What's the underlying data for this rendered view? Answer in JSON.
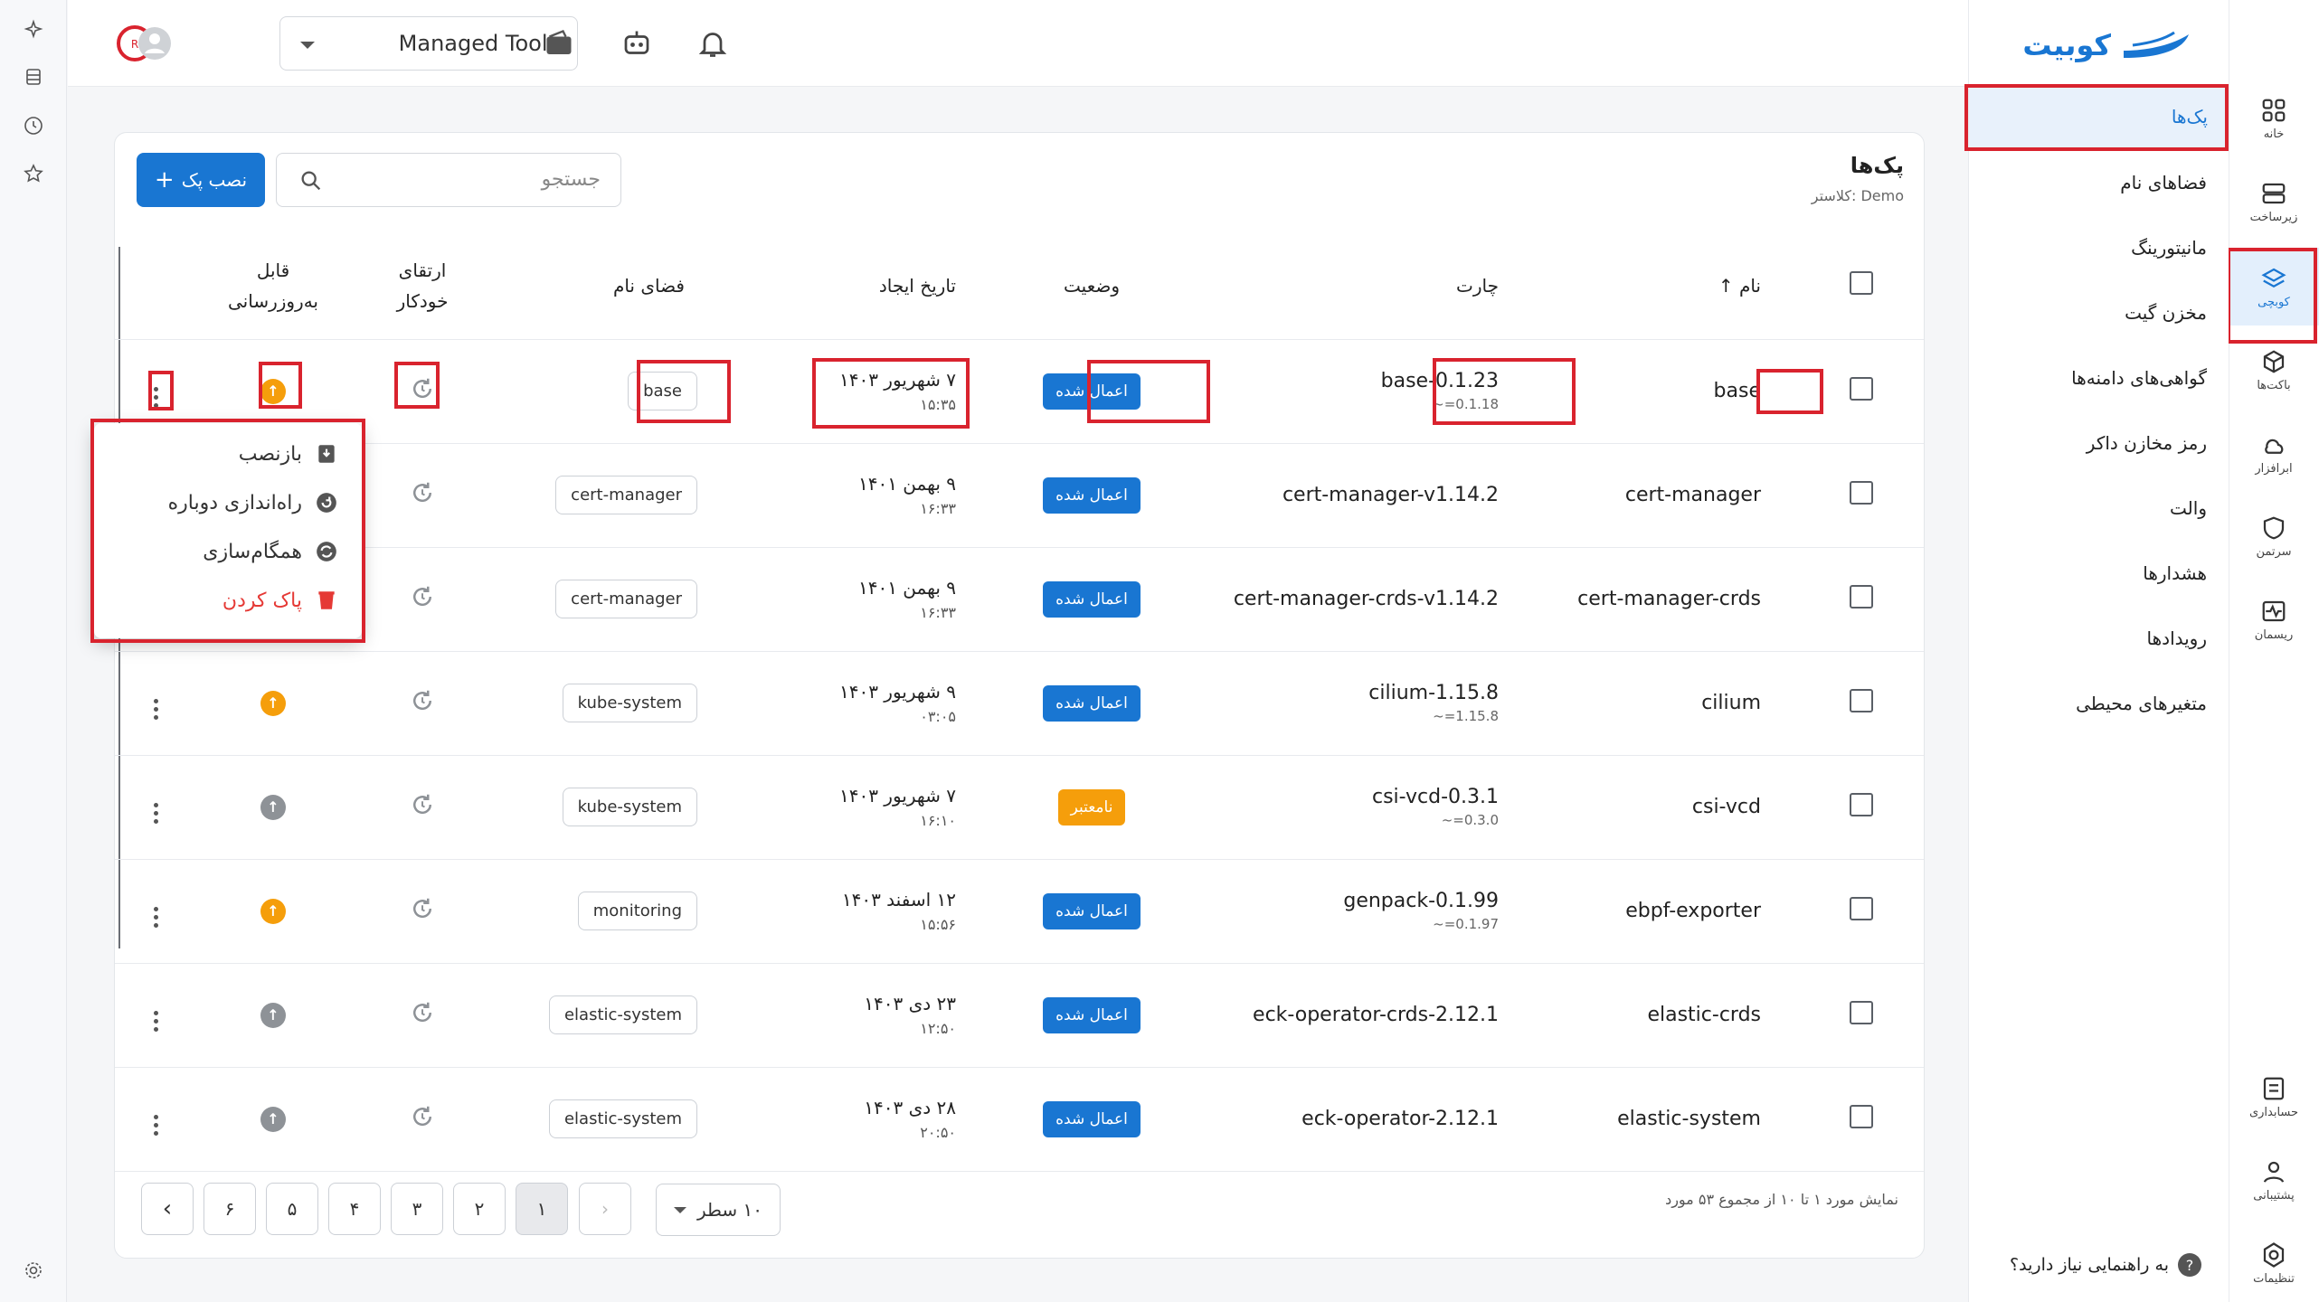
{
  "topbar": {
    "tool_selector": "Managed Tools",
    "icons": [
      "avatar-icon",
      "wallet-icon",
      "robot-icon",
      "bell-icon"
    ]
  },
  "brand": {
    "logo_text": "کوبیت",
    "accent": "#1976d2"
  },
  "rail": [
    {
      "label": "خانه",
      "icon": "home-grid-icon"
    },
    {
      "label": "زیرساخت",
      "icon": "server-icon"
    },
    {
      "label": "کوبچی",
      "icon": "layers-icon",
      "active": true
    },
    {
      "label": "باکت‌ها",
      "icon": "cube-icon"
    },
    {
      "label": "ابرافزار",
      "icon": "cloud-app-icon"
    },
    {
      "label": "سرتمن",
      "icon": "shield-icon"
    },
    {
      "label": "ریسمان",
      "icon": "pulse-icon"
    },
    {
      "label": "حسابداری",
      "icon": "billing-icon"
    },
    {
      "label": "پشتیبانی",
      "icon": "support-icon"
    },
    {
      "label": "تنظیمات",
      "icon": "settings-icon"
    }
  ],
  "subnav": {
    "items": [
      "پک‌ها",
      "فضاهای نام",
      "مانیتورینگ",
      "مخزن گیت",
      "گواهی‌های دامنه‌ها",
      "رمز مخازن داکر",
      "والت",
      "هشدارها",
      "رویدادها",
      "متغیرهای محیطی"
    ],
    "help": "به راهنمایی نیاز دارید؟"
  },
  "card": {
    "title": "پک‌ها",
    "subtitle": "کلاستر: Demo",
    "install_button": "نصب پک",
    "search_placeholder": "جستجو"
  },
  "table": {
    "headers": {
      "name": "نام",
      "chart": "چارت",
      "status": "وضعیت",
      "created": "تاریخ ایجاد",
      "namespace": "فضای نام",
      "auto_upgrade": "ارتقای خودکار",
      "updatable": "قابل به‌روزرسانی"
    },
    "rows": [
      {
        "name": "base",
        "chart": "base-0.1.23",
        "chart_sub": "~=0.1.18",
        "status": "اعمال شده",
        "date": "۷ شهریور ۱۴۰۳",
        "time": "۱۵:۳۵",
        "ns": "base",
        "upg": "on"
      },
      {
        "name": "cert-manager",
        "chart": "cert-manager-v1.14.2",
        "chart_sub": "",
        "status": "اعمال شده",
        "date": "۹ بهمن ۱۴۰۱",
        "time": "۱۶:۳۳",
        "ns": "cert-manager",
        "upg": "on"
      },
      {
        "name": "cert-manager-crds",
        "chart": "cert-manager-crds-v1.14.2",
        "chart_sub": "",
        "status": "اعمال شده",
        "date": "۹ بهمن ۱۴۰۱",
        "time": "۱۶:۳۳",
        "ns": "cert-manager",
        "upg": "on"
      },
      {
        "name": "cilium",
        "chart": "cilium-1.15.8",
        "chart_sub": "~=1.15.8",
        "status": "اعمال شده",
        "date": "۹ شهریور ۱۴۰۳",
        "time": "۰۳:۰۵",
        "ns": "kube-system",
        "upg": "on"
      },
      {
        "name": "csi-vcd",
        "chart": "csi-vcd-0.3.1",
        "chart_sub": "~=0.3.0",
        "status": "نامعتبر",
        "date": "۷ شهریور ۱۴۰۳",
        "time": "۱۶:۱۰",
        "ns": "kube-system",
        "upg": "off"
      },
      {
        "name": "ebpf-exporter",
        "chart": "genpack-0.1.99",
        "chart_sub": "~=0.1.97",
        "status": "اعمال شده",
        "date": "۱۲ اسفند ۱۴۰۳",
        "time": "۱۵:۵۶",
        "ns": "monitoring",
        "upg": "on"
      },
      {
        "name": "elastic-crds",
        "chart": "eck-operator-crds-2.12.1",
        "chart_sub": "",
        "status": "اعمال شده",
        "date": "۲۳ دی ۱۴۰۳",
        "time": "۱۲:۵۰",
        "ns": "elastic-system",
        "upg": "off"
      },
      {
        "name": "elastic-system",
        "chart": "eck-operator-2.12.1",
        "chart_sub": "",
        "status": "اعمال شده",
        "date": "۲۸ دی ۱۴۰۳",
        "time": "۲۰:۵۰",
        "ns": "elastic-system",
        "upg": "off"
      }
    ]
  },
  "context_menu": {
    "items": [
      {
        "label": "بازنصب",
        "icon": "reinstall-icon"
      },
      {
        "label": "راه‌اندازی دوباره",
        "icon": "restart-icon"
      },
      {
        "label": "همگام‌سازی",
        "icon": "sync-icon"
      },
      {
        "label": "پاک کردن",
        "icon": "trash-icon",
        "danger": true
      }
    ]
  },
  "pagination": {
    "summary": "نمایش مورد ۱ تا ۱۰ از مجموع ۵۳ مورد",
    "rows_per_page": "۱۰ سطر",
    "pages": [
      "۱",
      "۲",
      "۳",
      "۴",
      "۵",
      "۶"
    ]
  }
}
